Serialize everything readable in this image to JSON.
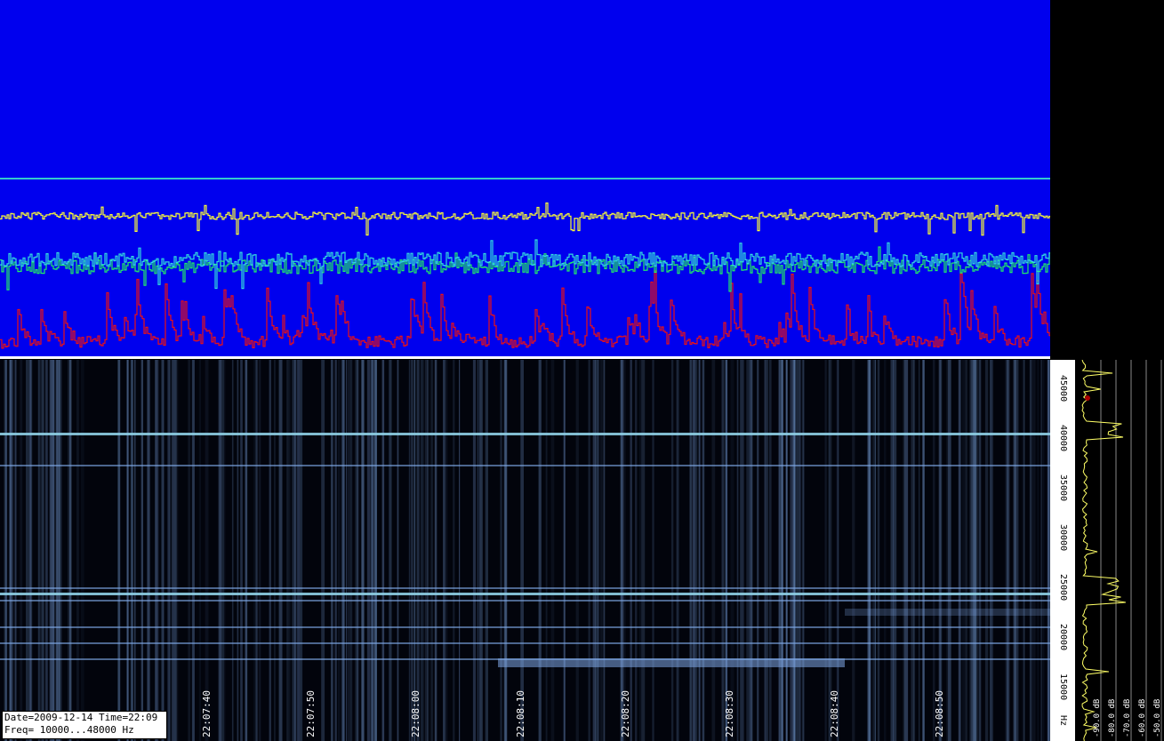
{
  "info": {
    "line1": "Date=2009-12-14 Time=22:09",
    "line2": "Freq= 10000...48000 Hz"
  },
  "time_axis": {
    "labels": [
      "30",
      "22:07:40",
      "22:07:50",
      "22:08:00",
      "22:08:10",
      "22:08:20",
      "22:08:30",
      "22:08:40",
      "22:08:50"
    ]
  },
  "freq_axis": {
    "labels": [
      "45000",
      "40000",
      "35000",
      "30000",
      "25000",
      "20000",
      "15000",
      "Hz"
    ]
  },
  "db_axis": {
    "labels": [
      "-90.0 dB",
      "-80.0 dB",
      "-70.0 dB",
      "-60.0 dB",
      "-50.0 dB"
    ]
  },
  "colors": {
    "scope_background": "#0000ee",
    "trace_yellow": "#ffff33",
    "trace_cyan": "#33dddd",
    "trace_green": "#22ee66",
    "trace_red": "#ee1111",
    "reference_line": "#33cccc",
    "waterfall_line": "#7fa8e6"
  }
}
